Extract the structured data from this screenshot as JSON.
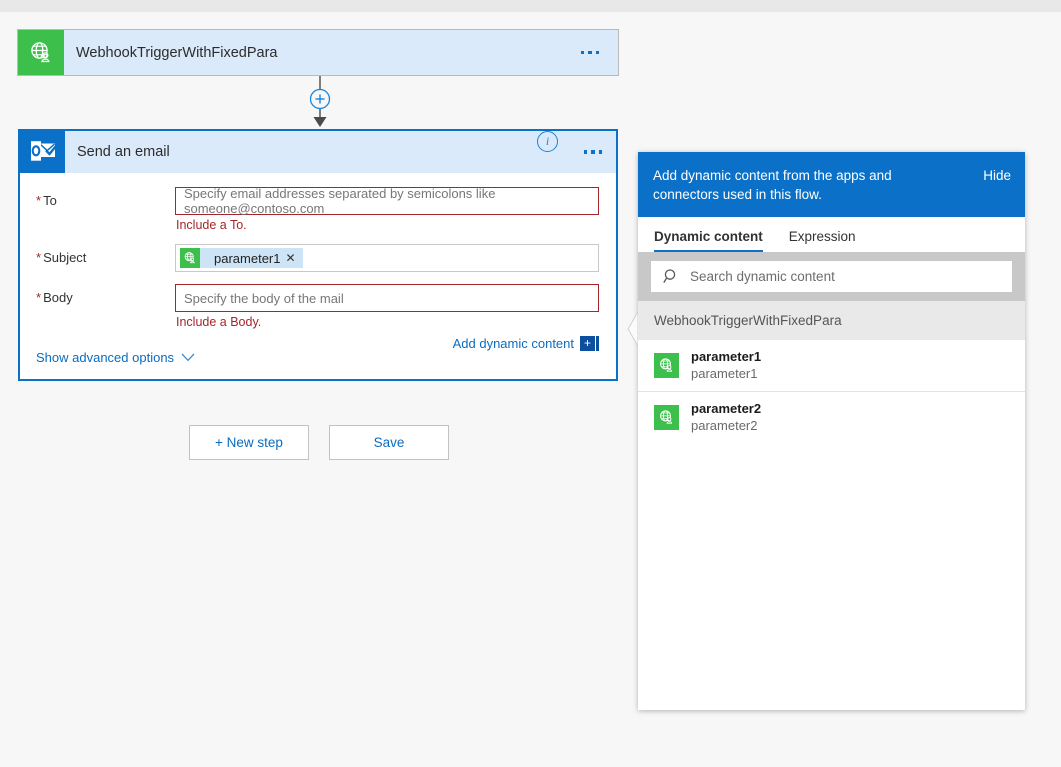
{
  "trigger_card": {
    "title": "WebhookTriggerWithFixedPara",
    "icon": "webhook-globe-icon",
    "more_label": "…"
  },
  "connector": {
    "add_label": "+"
  },
  "action_card": {
    "title": "Send an email",
    "icon": "outlook-icon",
    "info_label": "i",
    "fields": [
      {
        "label": "To",
        "required": true,
        "value": "",
        "placeholder": "Specify email addresses separated by semicolons like someone@contoso.com",
        "error": "Include a To.",
        "has_error": true
      },
      {
        "label": "Subject",
        "required": true,
        "token": "parameter1",
        "token_remove": "✕",
        "placeholder": "",
        "error": "",
        "has_error": false
      },
      {
        "label": "Body",
        "required": true,
        "value": "",
        "placeholder": "Specify the body of the mail",
        "error": "Include a Body.",
        "has_error": true
      }
    ],
    "add_dynamic_content_label": "Add dynamic content",
    "add_dynamic_content_plus": "+",
    "show_advanced_label": "Show advanced options"
  },
  "buttons": {
    "new_step": "+ New step",
    "save": "Save"
  },
  "dynamic_panel": {
    "banner_text": "Add dynamic content from the apps and connectors used in this flow.",
    "hide_label": "Hide",
    "tabs": [
      {
        "label": "Dynamic content",
        "active": true
      },
      {
        "label": "Expression",
        "active": false
      }
    ],
    "search_placeholder": "Search dynamic content",
    "group_header": "WebhookTriggerWithFixedPara",
    "items": [
      {
        "title": "parameter1",
        "subtitle": "parameter1",
        "icon": "webhook-globe-icon"
      },
      {
        "title": "parameter2",
        "subtitle": "parameter2",
        "icon": "webhook-globe-icon"
      }
    ]
  },
  "colors": {
    "accent_blue": "#0a70c8",
    "trigger_green": "#3dc04b",
    "card_header_blue": "#dbeafa",
    "error_red": "#a4262c",
    "link_blue": "#0a6cc0",
    "page_bg": "#f7f7f7"
  }
}
